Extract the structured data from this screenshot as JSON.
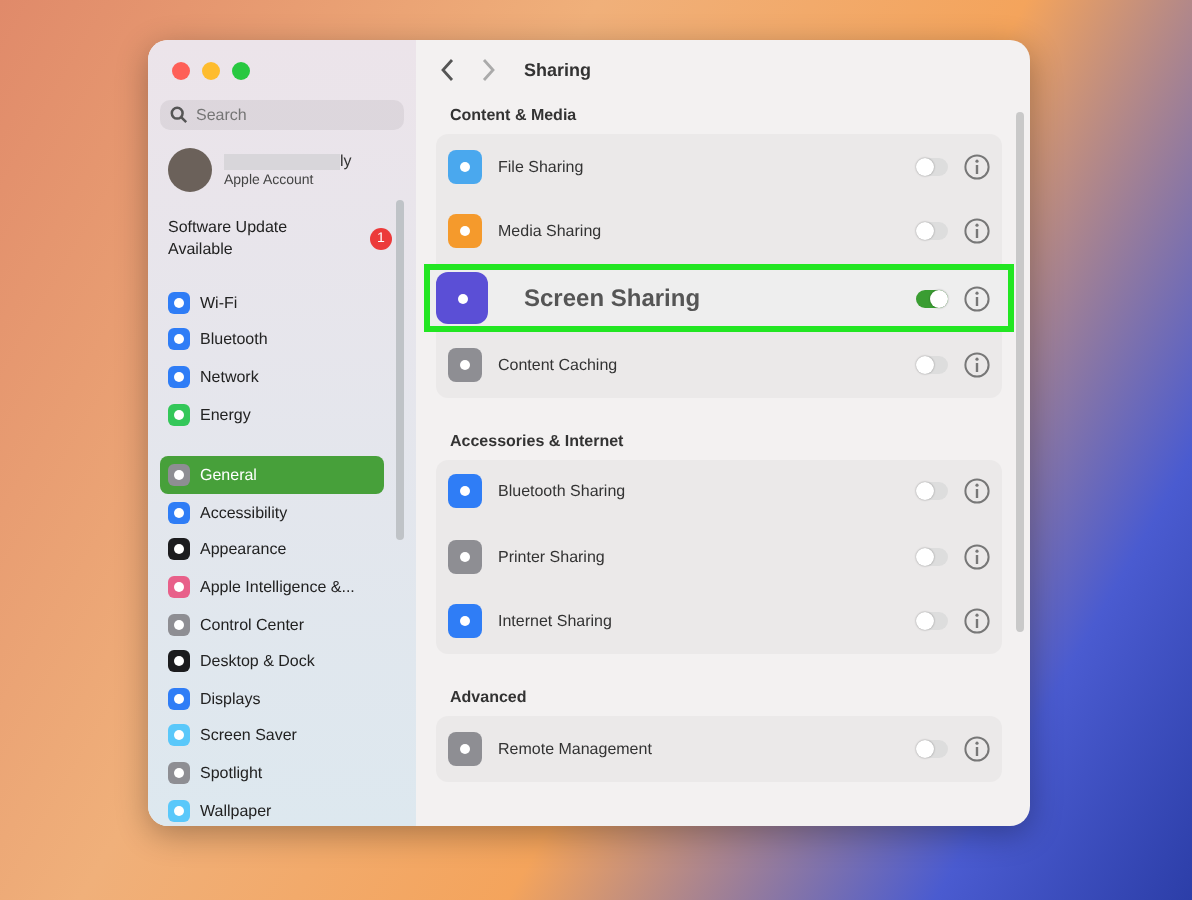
{
  "sidebar": {
    "search": {
      "placeholder": "Search"
    },
    "account": {
      "name": "ly",
      "subtitle": "Apple Account"
    },
    "update": {
      "label": "Software Update Available",
      "badge": "1"
    },
    "groups": [
      [
        {
          "label": "Wi-Fi",
          "color": "#2f7df6",
          "selected": false
        },
        {
          "label": "Bluetooth",
          "color": "#2f7df6",
          "selected": false
        },
        {
          "label": "Network",
          "color": "#2f7df6",
          "selected": false
        },
        {
          "label": "Energy",
          "color": "#34c759",
          "selected": false
        }
      ],
      [
        {
          "label": "General",
          "color": "#8e8e93",
          "selected": true
        },
        {
          "label": "Accessibility",
          "color": "#2f7df6",
          "selected": false
        },
        {
          "label": "Appearance",
          "color": "#1c1c1e",
          "selected": false
        },
        {
          "label": "Apple Intelligence &...",
          "color": "#e8608a",
          "selected": false
        },
        {
          "label": "Control Center",
          "color": "#8e8e93",
          "selected": false
        },
        {
          "label": "Desktop & Dock",
          "color": "#1c1c1e",
          "selected": false
        },
        {
          "label": "Displays",
          "color": "#2f7df6",
          "selected": false
        },
        {
          "label": "Screen Saver",
          "color": "#5ac8fa",
          "selected": false
        },
        {
          "label": "Spotlight",
          "color": "#8e8e93",
          "selected": false
        },
        {
          "label": "Wallpaper",
          "color": "#5ac8fa",
          "selected": false
        }
      ]
    ]
  },
  "content": {
    "title": "Sharing",
    "sections": [
      {
        "title": "Content & Media",
        "rows": [
          {
            "label": "File Sharing",
            "color": "#4aa8ee",
            "on": false,
            "highlighted": false
          },
          {
            "label": "Media Sharing",
            "color": "#f59a2c",
            "on": false,
            "highlighted": false
          },
          {
            "label": "Screen Sharing",
            "color": "#5b4fd6",
            "on": true,
            "highlighted": true
          },
          {
            "label": "Content Caching",
            "color": "#8e8e93",
            "on": false,
            "highlighted": false
          }
        ]
      },
      {
        "title": "Accessories & Internet",
        "rows": [
          {
            "label": "Bluetooth Sharing",
            "color": "#2f7df6",
            "on": false,
            "highlighted": false
          },
          {
            "label": "Printer Sharing",
            "color": "#8e8e93",
            "on": false,
            "highlighted": false
          },
          {
            "label": "Internet Sharing",
            "color": "#2f7df6",
            "on": false,
            "highlighted": false
          }
        ]
      },
      {
        "title": "Advanced",
        "rows": [
          {
            "label": "Remote Management",
            "color": "#8e8e93",
            "on": false,
            "highlighted": false
          }
        ]
      }
    ]
  }
}
